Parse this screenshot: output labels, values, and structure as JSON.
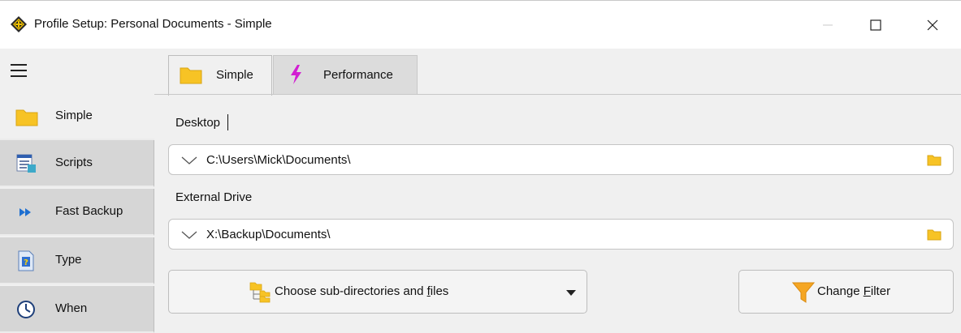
{
  "window": {
    "title": "Profile Setup: Personal Documents - Simple",
    "app_icon": "app-logo-icon",
    "controls": [
      "minimize-icon",
      "maximize-icon",
      "close-icon"
    ]
  },
  "sidebar": {
    "menu_icon": "hamburger-icon",
    "items": [
      {
        "label": "Simple",
        "icon": "folder-icon",
        "active": true
      },
      {
        "label": "Scripts",
        "icon": "scripts-icon",
        "active": false
      },
      {
        "label": "Fast Backup",
        "icon": "fast-forward-icon",
        "active": false
      },
      {
        "label": "Type",
        "icon": "type-doc-icon",
        "active": false
      },
      {
        "label": "When",
        "icon": "clock-icon",
        "active": false
      }
    ]
  },
  "tabs": [
    {
      "label": "Simple",
      "icon": "folder-icon",
      "active": true
    },
    {
      "label": "Performance",
      "icon": "lightning-icon",
      "active": false
    }
  ],
  "source": {
    "label": "Desktop",
    "path": "C:\\Users\\Mick\\Documents\\"
  },
  "destination": {
    "label": "External Drive",
    "path": "X:\\Backup\\Documents\\"
  },
  "buttons": {
    "choose": {
      "pre": "Choose sub-directories and ",
      "mnemonic": "f",
      "post": "iles"
    },
    "filter": {
      "pre": "Change ",
      "mnemonic": "F",
      "post": "ilter"
    }
  },
  "colors": {
    "folder": "#f7c325",
    "lightning": "#d21fd2",
    "accent_blue": "#1e6fd0"
  }
}
